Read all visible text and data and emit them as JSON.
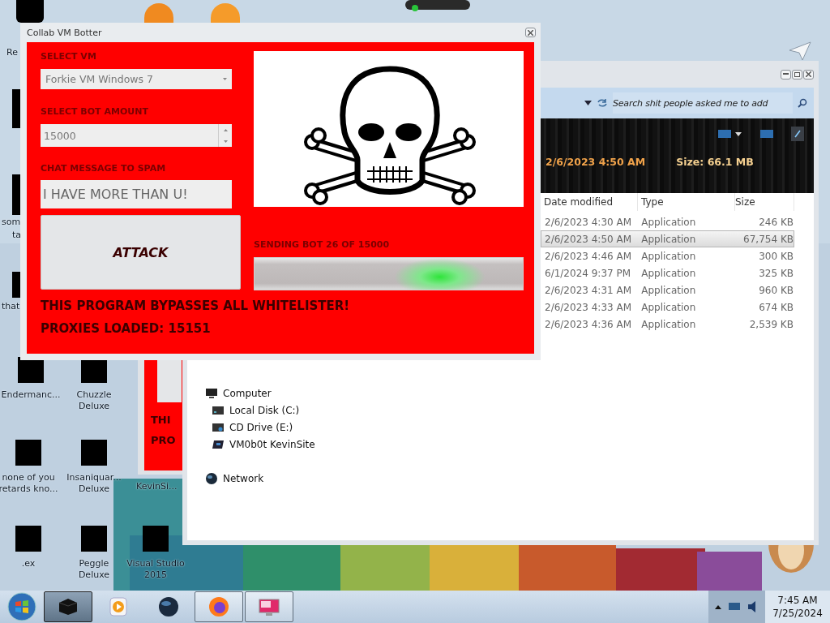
{
  "desktop": {
    "icons": [
      {
        "label": "Re",
        "kind": "fragment"
      },
      {
        "label": "som",
        "kind": "fragment"
      },
      {
        "label": "ta",
        "kind": "fragment"
      },
      {
        "label": "that",
        "kind": "fragment"
      },
      {
        "label": "Endermanc...",
        "kind": "icon"
      },
      {
        "label": "Chuzzle Deluxe",
        "kind": "icon"
      },
      {
        "label": "none of you retards kno...",
        "kind": "icon"
      },
      {
        "label": "Insaniquar... Deluxe",
        "kind": "icon"
      },
      {
        "label": "KevinSi...",
        "kind": "fragment"
      },
      {
        "label": ".ex",
        "kind": "icon"
      },
      {
        "label": "Peggle Deluxe",
        "kind": "icon"
      },
      {
        "label": "Visual Studio 2015",
        "kind": "icon"
      }
    ]
  },
  "background_window": {
    "lines": [
      "THI",
      "PRO"
    ]
  },
  "botter": {
    "title": "Collab VM Botter",
    "vm_label": "SELECT VM",
    "vm_value": "Forkie VM Windows 7",
    "amount_label": "SELECT BOT AMOUNT",
    "amount_value": "15000",
    "message_label": "CHAT MESSAGE TO SPAM",
    "message_value": "I HAVE MORE THAN U!",
    "attack_button": "ATTACK",
    "progress_label": "SENDING BOT 26 OF 15000",
    "progress": {
      "kind": "marquee"
    },
    "notice": "THIS PROGRAM BYPASSES ALL WHITELISTER!",
    "proxies": "PROXIES LOADED: 15151"
  },
  "explorer": {
    "search": {
      "placeholder": "Search shit people asked me to add"
    },
    "details": {
      "date": "2/6/2023 4:50 AM",
      "size": "Size: 66.1 MB"
    },
    "columns": [
      "Date modified",
      "Type",
      "Size"
    ],
    "rows": [
      {
        "date": "2/6/2023 4:30 AM",
        "type": "Application",
        "size": "246 KB",
        "selected": false
      },
      {
        "date": "2/6/2023 4:50 AM",
        "type": "Application",
        "size": "67,754 KB",
        "selected": true
      },
      {
        "date": "2/6/2023 4:46 AM",
        "type": "Application",
        "size": "300 KB",
        "selected": false
      },
      {
        "date": "6/1/2024 9:37 PM",
        "type": "Application",
        "size": "325 KB",
        "selected": false
      },
      {
        "date": "2/6/2023 4:31 AM",
        "type": "Application",
        "size": "960 KB",
        "selected": false
      },
      {
        "date": "2/6/2023 4:33 AM",
        "type": "Application",
        "size": "674 KB",
        "selected": false
      },
      {
        "date": "2/6/2023 4:36 AM",
        "type": "Application",
        "size": "2,539 KB",
        "selected": false
      }
    ],
    "nav": [
      {
        "label": "Computer",
        "kind": "computer",
        "children": [
          {
            "label": "Local Disk (C:)",
            "kind": "disk"
          },
          {
            "label": "CD Drive (E:)",
            "kind": "cd"
          },
          {
            "label": "VM0b0t KevinSite",
            "kind": "share"
          }
        ]
      },
      {
        "label": "Network",
        "kind": "network"
      }
    ]
  },
  "taskbar": {
    "items": [
      {
        "kind": "cube",
        "open": true,
        "selected": true
      },
      {
        "kind": "play",
        "open": false,
        "selected": false
      },
      {
        "kind": "sphere",
        "open": false,
        "selected": false
      },
      {
        "kind": "browser",
        "open": true,
        "selected": false
      },
      {
        "kind": "monitor",
        "open": true,
        "selected": false
      }
    ],
    "clock": {
      "time": "7:45 AM",
      "date": "7/25/2024"
    }
  }
}
